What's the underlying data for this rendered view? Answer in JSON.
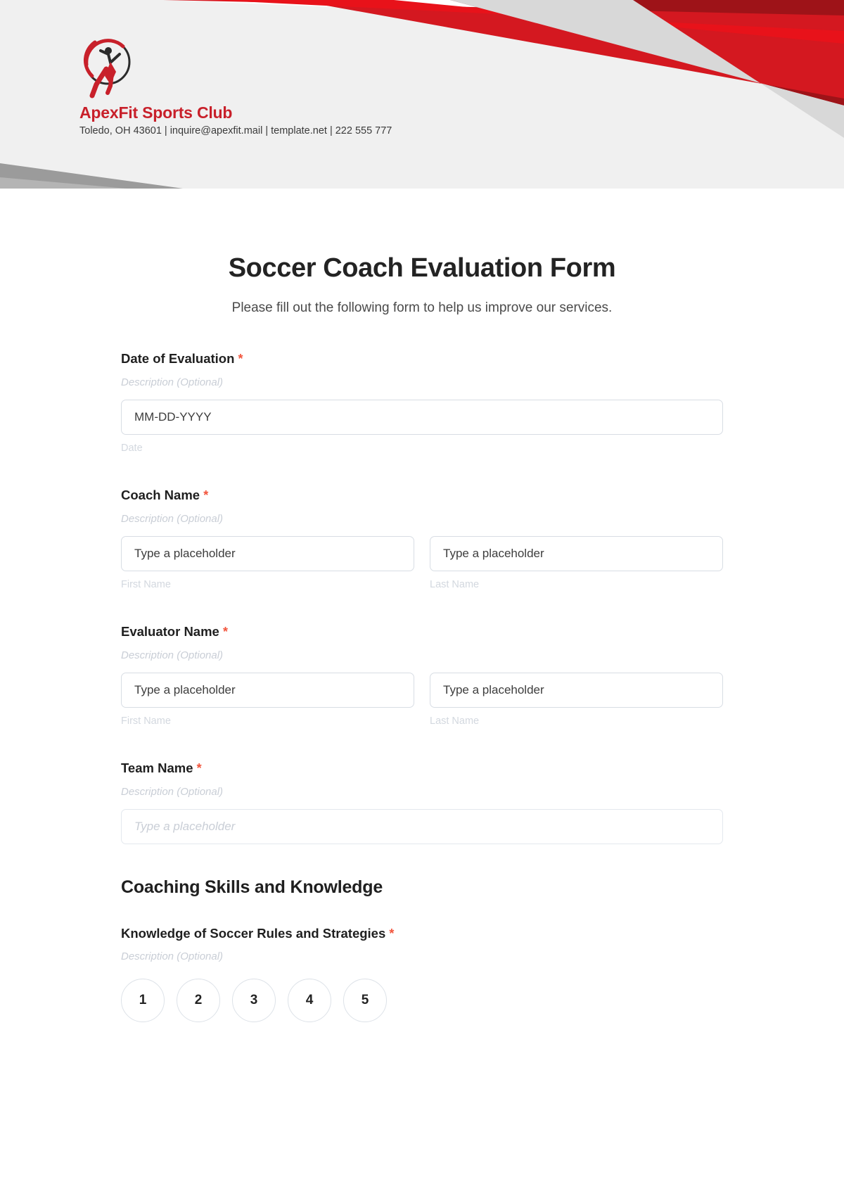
{
  "header": {
    "logo_icon": "athlete-circle-logo",
    "brand_name": "ApexFit Sports Club",
    "contact_line": "Toledo, OH 43601 | inquire@apexfit.mail | template.net | 222 555 777",
    "colors": {
      "brand_red": "#c8202a",
      "band_red_dark": "#9e1318",
      "band_red_bright": "#e8121a",
      "band_gray": "#9b9b9b",
      "header_bg": "#f0f0f0"
    }
  },
  "form": {
    "title": "Soccer Coach Evaluation Form",
    "subtitle": "Please fill out the following form to help us improve our services.",
    "required_marker": "*",
    "description_placeholder": "Description (Optional)",
    "fields": [
      {
        "label": "Date of Evaluation",
        "description": "Description (Optional)",
        "inputs": [
          {
            "placeholder": "MM-DD-YYYY",
            "value": "MM-DD-YYYY",
            "sub_label": "Date",
            "style": "solid"
          }
        ]
      },
      {
        "label": "Coach Name",
        "description": "Description (Optional)",
        "inputs": [
          {
            "placeholder": "Type a placeholder",
            "value": "Type a placeholder",
            "sub_label": "First Name",
            "style": "solid"
          },
          {
            "placeholder": "Type a placeholder",
            "value": "Type a placeholder",
            "sub_label": "Last Name",
            "style": "solid"
          }
        ]
      },
      {
        "label": "Evaluator Name",
        "description": "Description (Optional)",
        "inputs": [
          {
            "placeholder": "Type a placeholder",
            "value": "Type a placeholder",
            "sub_label": "First Name",
            "style": "solid"
          },
          {
            "placeholder": "Type a placeholder",
            "value": "Type a placeholder",
            "sub_label": "Last Name",
            "style": "solid"
          }
        ]
      },
      {
        "label": "Team Name",
        "description": "Description (Optional)",
        "inputs": [
          {
            "placeholder": "Type a placeholder",
            "value": "Type a placeholder",
            "sub_label": "",
            "style": "faint"
          }
        ]
      }
    ],
    "section": {
      "heading": "Coaching Skills and Knowledge",
      "question": {
        "label": "Knowledge of Soccer Rules and Strategies",
        "description": "Description (Optional)",
        "rating_options": [
          "1",
          "2",
          "3",
          "4",
          "5"
        ]
      }
    }
  }
}
